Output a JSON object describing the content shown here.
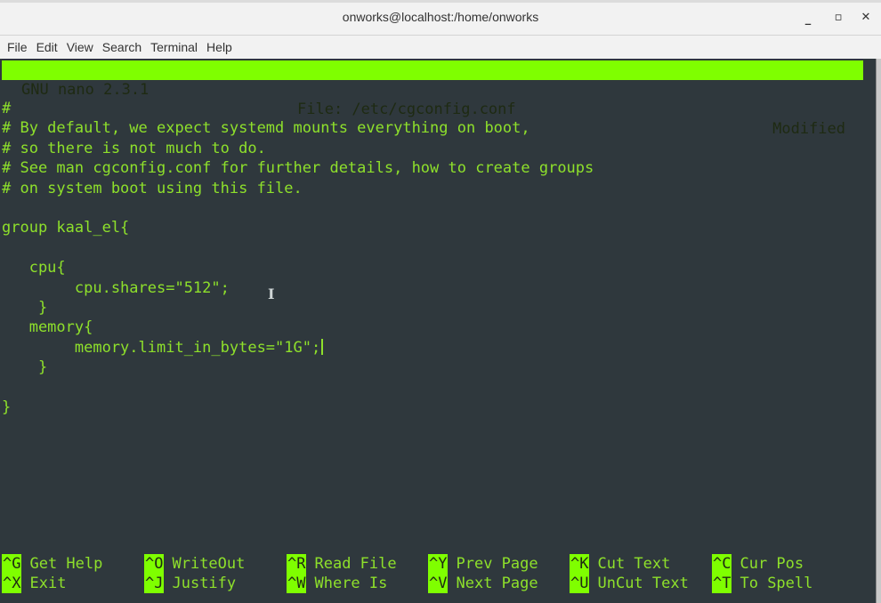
{
  "window": {
    "title": "onworks@localhost:/home/onworks",
    "controls": {
      "minimize": "_",
      "maximize": "▫",
      "close": "✕"
    }
  },
  "menu": [
    "File",
    "Edit",
    "View",
    "Search",
    "Terminal",
    "Help"
  ],
  "nano": {
    "version_label": "GNU nano 2.3.1",
    "file_label": "File: /etc/cgconfig.conf",
    "status": "Modified"
  },
  "file_lines": [
    "#",
    "# By default, we expect systemd mounts everything on boot,",
    "# so there is not much to do.",
    "# See man cgconfig.conf for further details, how to create groups",
    "# on system boot using this file.",
    "",
    "group kaal_el{",
    "",
    "   cpu{",
    "        cpu.shares=\"512\";",
    "    }",
    "   memory{",
    "        memory.limit_in_bytes=\"1G\";",
    "    }",
    "",
    "}"
  ],
  "cursor_line": 12,
  "shortcuts": {
    "row1": [
      {
        "key": "^G",
        "label": "Get Help"
      },
      {
        "key": "^O",
        "label": "WriteOut"
      },
      {
        "key": "^R",
        "label": "Read File"
      },
      {
        "key": "^Y",
        "label": "Prev Page"
      },
      {
        "key": "^K",
        "label": "Cut Text"
      },
      {
        "key": "^C",
        "label": "Cur Pos"
      }
    ],
    "row2": [
      {
        "key": "^X",
        "label": "Exit"
      },
      {
        "key": "^J",
        "label": "Justify"
      },
      {
        "key": "^W",
        "label": "Where Is"
      },
      {
        "key": "^V",
        "label": "Next Page"
      },
      {
        "key": "^U",
        "label": "UnCut Text"
      },
      {
        "key": "^T",
        "label": "To Spell"
      }
    ]
  },
  "colors": {
    "terminal_bg": "#2f383d",
    "text_green": "#8ee02b",
    "highlight_green": "#7fff00"
  }
}
